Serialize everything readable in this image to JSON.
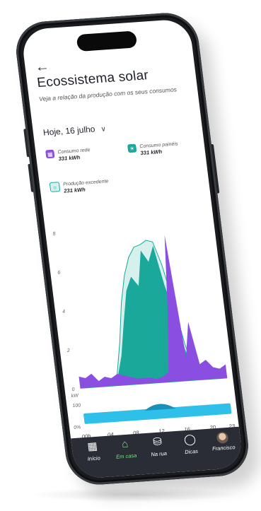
{
  "header": {
    "back_icon": "arrow-left-icon",
    "title": "Ecossistema solar",
    "subtitle": "Veja a relação da produção com os seus consumos"
  },
  "date_selector": {
    "label": "Hoje, 16 julho",
    "icon": "chevron-down-icon"
  },
  "legend": [
    {
      "label": "Consumo rede",
      "value": "331 kWh",
      "icon": "grid-tower-icon",
      "color": "#8a4fe0"
    },
    {
      "label": "Consumo painéis",
      "value": "331 kWh",
      "icon": "sun-icon",
      "color": "#1aa89b"
    },
    {
      "label": "Produção excedente",
      "value": "231 kWh",
      "icon": "sun-outline-icon",
      "color": "#d6f0ee"
    }
  ],
  "chart_data": {
    "type": "area",
    "unit": "kW",
    "y_ticks": [
      "8",
      "6",
      "4",
      "2",
      "0"
    ],
    "ylim": [
      0,
      8
    ],
    "x_ticks": [
      "00h",
      "04",
      "08",
      "12",
      "16",
      "20",
      "23"
    ],
    "series": [
      {
        "color": "#8a4fe0",
        "x": [
          0,
          1,
          2,
          3,
          4,
          5,
          6,
          7,
          8,
          9,
          10,
          11,
          12,
          13,
          14,
          15,
          16,
          17,
          18,
          19,
          20,
          21,
          22,
          23
        ],
        "values": [
          0.6,
          0.5,
          0.7,
          0.3,
          0.5,
          0.4,
          0.6,
          0.5,
          0.4,
          0.3,
          0.3,
          0.3,
          0.2,
          0.3,
          0.5,
          3.5,
          7.5,
          1.2,
          3.0,
          0.8,
          1.0,
          0.6,
          0.5,
          0.7
        ]
      },
      {
        "color": "#1aa89b",
        "x": [
          0,
          1,
          2,
          3,
          4,
          5,
          6,
          7,
          8,
          9,
          10,
          11,
          12,
          13,
          14,
          15,
          16,
          17,
          18,
          19,
          20,
          21,
          22,
          23
        ],
        "values": [
          0,
          0,
          0,
          0,
          0,
          0,
          0.4,
          1.5,
          3.2,
          4.8,
          5.5,
          5.0,
          6.8,
          6.2,
          7.0,
          5.0,
          3.5,
          1.6,
          0.3,
          0,
          0,
          0,
          0,
          0
        ]
      },
      {
        "color": "#d6f0ee",
        "x": [
          0,
          1,
          2,
          3,
          4,
          5,
          6,
          7,
          8,
          9,
          10,
          11,
          12,
          13,
          14,
          15,
          16,
          17,
          18,
          19,
          20,
          21,
          22,
          23
        ],
        "values": [
          0,
          0,
          0,
          0,
          0,
          0,
          0.6,
          2.2,
          4.2,
          5.6,
          6.5,
          7.0,
          7.1,
          7.3,
          7.2,
          6.0,
          4.2,
          2.0,
          0.5,
          0,
          0,
          0,
          0,
          0
        ]
      }
    ]
  },
  "mini_chart": {
    "labels": [
      "100",
      "0%"
    ],
    "color": "#2ec0e8",
    "bump_color": "#1a8fb8"
  },
  "nav": [
    {
      "label": "Início",
      "icon": "grid-icon",
      "active": false
    },
    {
      "label": "Em casa",
      "icon": "home-icon",
      "active": true
    },
    {
      "label": "Na rua",
      "icon": "car-icon",
      "active": false
    },
    {
      "label": "Dicas",
      "icon": "bulb-icon",
      "active": false
    },
    {
      "label": "Francisco",
      "icon": "avatar-icon",
      "active": false
    }
  ]
}
